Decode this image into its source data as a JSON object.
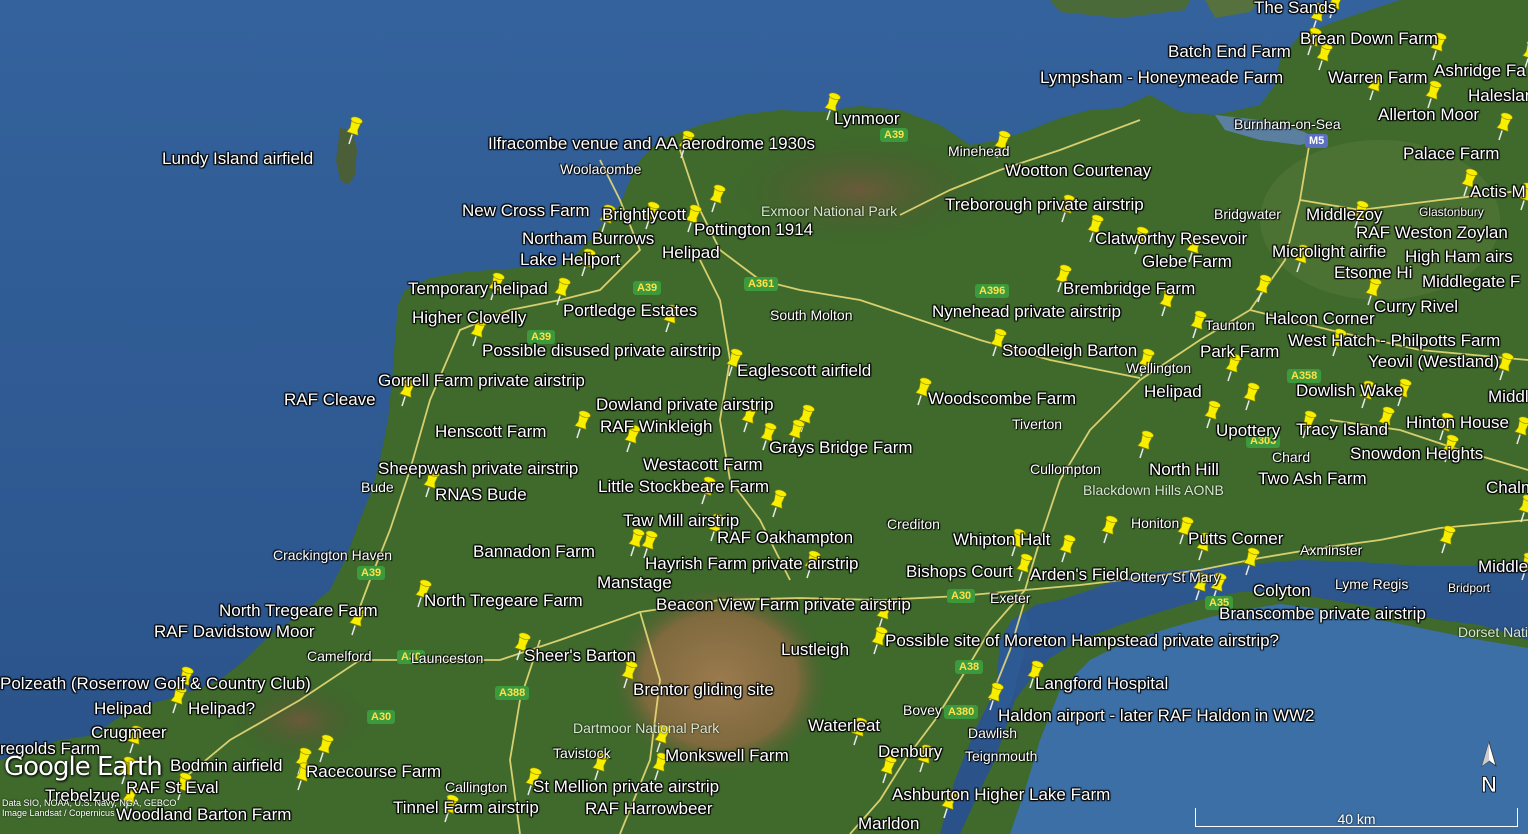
{
  "map": {
    "brand": "Google Earth",
    "credits": [
      "Data SIO, NOAA, U.S. Navy, NGA, GEBCO",
      "Image Landsat / Copernicus"
    ],
    "scale_label": "40 km",
    "north_label": "N",
    "colors": {
      "sea": "#2e5a94",
      "land": "#3f6a2c",
      "moor": "#8a6e44",
      "road": "#f2e17a",
      "pin": "#f7ee00"
    },
    "pin_icon": "yellow-pushpin-icon",
    "placemarks": [
      "The Sands",
      "Brean Down Farm",
      "Batch End Farm",
      "Lympsham - Honeymeade Farm",
      "Warren Farm",
      "Ashridge Fa",
      "Haleslan",
      "Allerton Moor",
      "Lynmoor",
      "Ilfracombe venue and AA aerodrome 1930s",
      "Lundy Island airfield",
      "Palace Farm",
      "Wootton Courtenay",
      "Actis M",
      "Treborough private airstrip",
      "Middlezoy",
      "RAF Weston Zoylan",
      "New Cross Farm",
      "Brightlycott",
      "Pottington 1914",
      "Clatworthy Resevoir",
      "Microlight airfie",
      "High Ham airs",
      "Northam Burrows",
      "Helipad",
      "Glebe Farm",
      "Etsome Hi",
      "Middlegate F",
      "Lake Heliport",
      "Temporary helipad",
      "Brembridge Farm",
      "Curry Rivel",
      "Portledge Estates",
      "Nynehead private airstrip",
      "Halcon Corner",
      "Higher Clovelly",
      "West Hatch - Philpotts Farm",
      "Possible disused private airstrip",
      "Stoodleigh Barton",
      "Park Farm",
      "Yeovil (Westland)",
      "Eaglescott airfield",
      "Gorrell Farm private airstrip",
      "Helipad",
      "Dowlish Wake",
      "RAF Cleave",
      "Woodscombe Farm",
      "Dowland private airstrip",
      "Middle",
      "RAF Winkleigh",
      "Henscott Farm",
      "Upottery",
      "Tracy Island",
      "Hinton House",
      "Grays Bridge Farm",
      "Snowdon Heights",
      "Sheepwash private airstrip",
      "Westacott Farm",
      "North Hill",
      "Two Ash Farm",
      "Little Stockbeare Farm",
      "Chalmin",
      "RNAS Bude",
      "Taw Mill airstrip",
      "RAF Oakhampton",
      "Whipton Halt",
      "Putts Corner",
      "Bannadon Farm",
      "Hayrish Farm private airstrip",
      "Middle P",
      "Bishops Court",
      "Arden's Field",
      "Manstage",
      "Colyton",
      "Beacon View Farm private airstrip",
      "North Tregeare Farm",
      "North Tregeare Farm",
      "Branscombe private airstrip",
      "RAF Davidstow Moor",
      "Possible site of Moreton Hampstead private airstrip?",
      "Lustleigh",
      "Sheer's Barton",
      "Polzeath (Roserrow Golf & Country Club)",
      "Langford Hospital",
      "Brentor gliding site",
      "Helipad",
      "Helipad?",
      "Haldon airport - later RAF Haldon in WW2",
      "Waterleat",
      "Crugmeer",
      "Denbury",
      "regolds Farm",
      "Monkswell Farm",
      "Bodmin airfield",
      "Racecourse Farm",
      "St Mellion private airstrip",
      "RAF St Eval",
      "Trebelzue",
      "Ashburton Higher Lake Farm",
      "Tinnel Farm airstrip",
      "RAF Harrowbeer",
      "Woodland Barton Farm",
      "Marldon"
    ],
    "places": [
      "Burnham-on-Sea",
      "Woolacombe",
      "Minehead",
      "Bridgwater",
      "Glastonbury",
      "Taunton",
      "South Molton",
      "Wellington",
      "Tiverton",
      "Chard",
      "Cullompton",
      "Bude",
      "Crediton",
      "Honiton",
      "Crackington Haven",
      "Axminster",
      "Exeter",
      "Ottery St Mary",
      "Lyme Regis",
      "Bridport",
      "Camelford",
      "Launceston",
      "Bovey",
      "Dawlish",
      "Teignmouth",
      "Tavistock",
      "Callington"
    ],
    "parks": [
      "Exmoor National Park",
      "Blackdown Hills AONB",
      "Dartmoor National Park",
      "Dorset Nati"
    ],
    "roads": [
      "A39",
      "A361",
      "A396",
      "M5",
      "A358",
      "A303",
      "A39",
      "A39",
      "A39",
      "A30",
      "A30",
      "A30",
      "A388",
      "A38",
      "A380",
      "A35"
    ]
  }
}
